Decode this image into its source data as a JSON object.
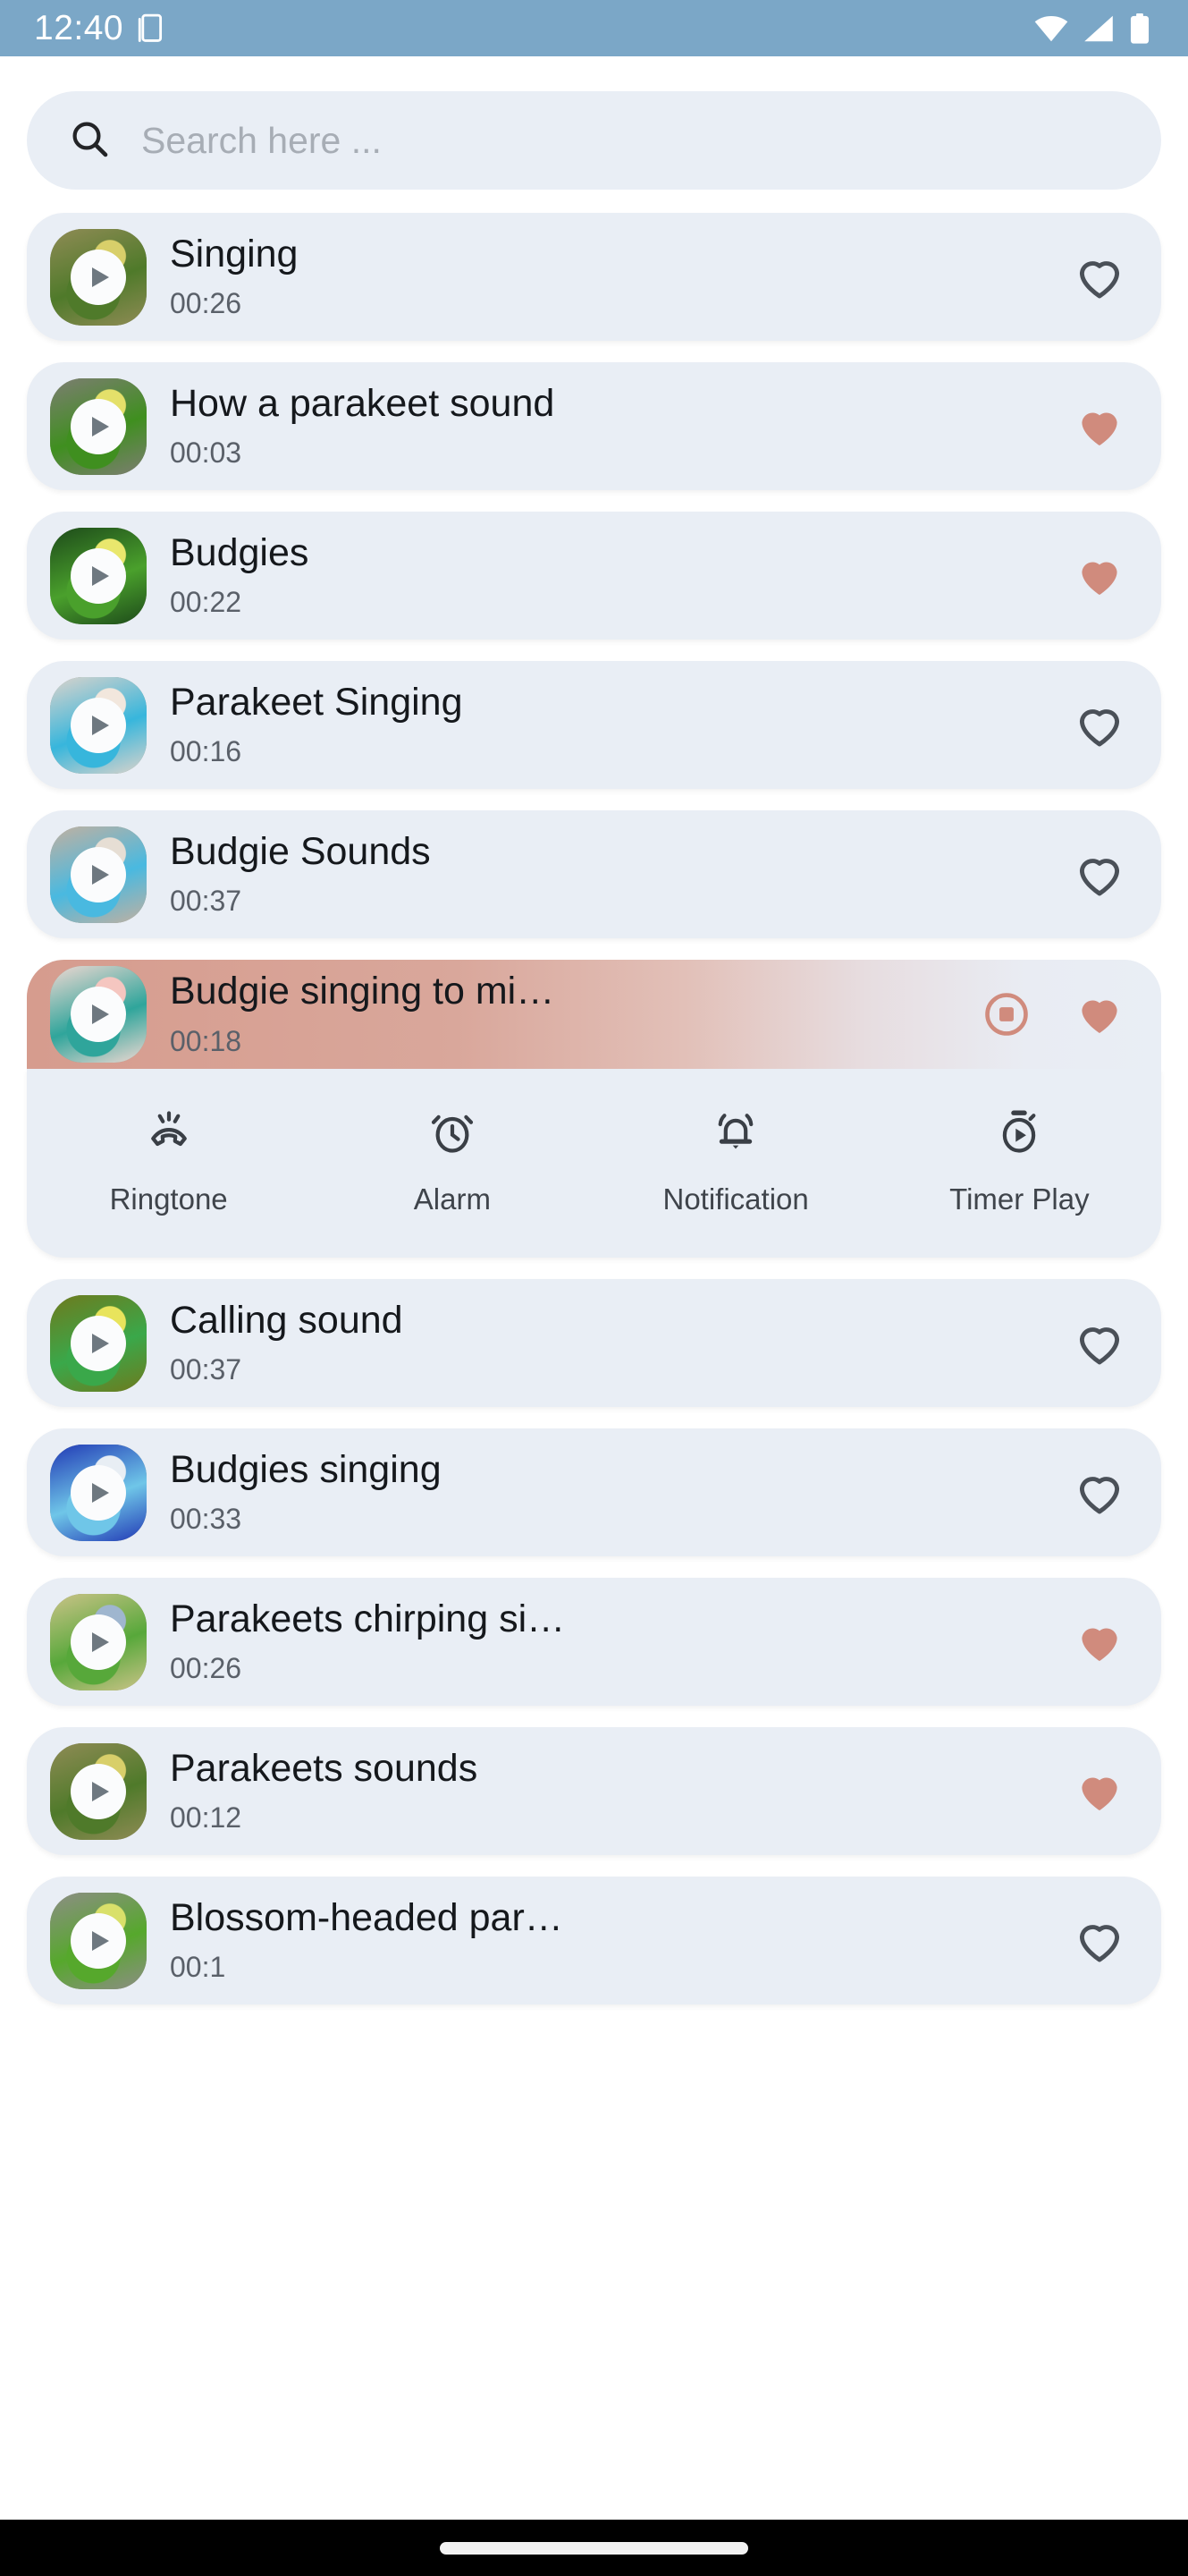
{
  "status_bar": {
    "time": "12:40",
    "icons": [
      "screenshot-icon",
      "wifi-icon",
      "cellular-signal-icon",
      "battery-icon"
    ],
    "background_color": "#7ba7c7"
  },
  "search": {
    "placeholder": "Search here ...",
    "value": "",
    "icon": "search-icon"
  },
  "theme": {
    "card_background": "#e9eef5",
    "favorite_active_color": "#d08b7d",
    "favorite_inactive_color": "#4a5058",
    "playing_gradient_start": "#d69c8e",
    "page_background": "#ffffff"
  },
  "expanded_actions": [
    {
      "label": "Ringtone",
      "icon": "ringing-phone-icon"
    },
    {
      "label": "Alarm",
      "icon": "alarm-clock-icon"
    },
    {
      "label": "Notification",
      "icon": "bell-icon"
    },
    {
      "label": "Timer Play",
      "icon": "stopwatch-play-icon"
    }
  ],
  "sounds": [
    {
      "title": "Singing",
      "duration": "00:26",
      "favorite": false,
      "playing": false,
      "thumb_colors": [
        "#8f8b55",
        "#4f7a2a",
        "#d8cf6a"
      ]
    },
    {
      "title": "How a parakeet sound",
      "duration": "00:03",
      "favorite": true,
      "playing": false,
      "thumb_colors": [
        "#7d7d72",
        "#3f8f1f",
        "#e4e06a"
      ]
    },
    {
      "title": "Budgies",
      "duration": "00:22",
      "favorite": true,
      "playing": false,
      "thumb_colors": [
        "#1d4a1a",
        "#4aa02c",
        "#e9e76d"
      ]
    },
    {
      "title": "Parakeet Singing",
      "duration": "00:16",
      "favorite": false,
      "playing": false,
      "thumb_colors": [
        "#dcd3cb",
        "#37b6dc",
        "#f2e7dd"
      ]
    },
    {
      "title": "Budgie Sounds",
      "duration": "00:37",
      "favorite": false,
      "playing": false,
      "thumb_colors": [
        "#c2b0a0",
        "#49b9e0",
        "#e6ded4"
      ]
    },
    {
      "title": "Budgie singing to mi…",
      "duration": "00:18",
      "favorite": true,
      "playing": true,
      "thumb_colors": [
        "#f0d8d2",
        "#2fa59b",
        "#f5c6c0"
      ]
    },
    {
      "title": "Calling sound",
      "duration": "00:37",
      "favorite": false,
      "playing": false,
      "thumb_colors": [
        "#6e7a1e",
        "#3aa84a",
        "#e8e45c"
      ]
    },
    {
      "title": "Budgies singing",
      "duration": "00:33",
      "favorite": false,
      "playing": false,
      "thumb_colors": [
        "#2139b5",
        "#6fc6e8",
        "#e8eef4"
      ]
    },
    {
      "title": "Parakeets chirping si…",
      "duration": "00:26",
      "favorite": true,
      "playing": false,
      "thumb_colors": [
        "#cbc388",
        "#57a83a",
        "#9fb6cf"
      ]
    },
    {
      "title": "Parakeets sounds",
      "duration": "00:12",
      "favorite": true,
      "playing": false,
      "thumb_colors": [
        "#8f8b55",
        "#4f7a2a",
        "#d8cf6a"
      ]
    },
    {
      "title": "Blossom-headed par…",
      "duration": "00:1",
      "favorite": false,
      "playing": false,
      "thumb_colors": [
        "#8d8d85",
        "#56a82c",
        "#d9e06a"
      ]
    }
  ],
  "nav_bar": {
    "gesture_pill": "home-gesture-pill"
  }
}
